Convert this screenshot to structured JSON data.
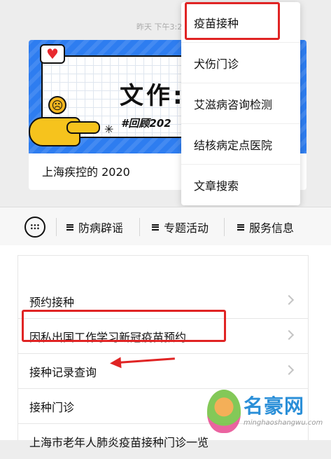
{
  "article": {
    "timestamp": "昨天 下午3:2",
    "banner_title": "文作:",
    "banner_subtitle": "#回顾202",
    "caption": "上海疾控的 2020"
  },
  "popup_menu": {
    "items": [
      {
        "label": "疫苗接种",
        "highlighted": true
      },
      {
        "label": "犬伤门诊",
        "highlighted": false
      },
      {
        "label": "艾滋病咨询检测",
        "highlighted": false
      },
      {
        "label": "结核病定点医院",
        "highlighted": false
      },
      {
        "label": "文章搜索",
        "highlighted": false
      }
    ]
  },
  "menu_bar": {
    "keyboard_icon": "keyboard-icon",
    "tabs": [
      {
        "label": "防病辟谣"
      },
      {
        "label": "专题活动"
      },
      {
        "label": "服务信息"
      }
    ]
  },
  "list": {
    "items": [
      {
        "label": "预约接种"
      },
      {
        "label": "因私出国工作学习新冠疫苗预约",
        "highlighted": true
      },
      {
        "label": "接种记录查询",
        "arrow": true
      },
      {
        "label": "接种门诊"
      },
      {
        "label": "上海市老年人肺炎疫苗接种门诊一览"
      }
    ]
  },
  "watermark": {
    "title": "名豪网",
    "url": "minghaoshangwu.com"
  },
  "colors": {
    "highlight": "#e02424",
    "banner_blue": "#2e7df0",
    "watermark_blue": "#2a8fd8"
  }
}
